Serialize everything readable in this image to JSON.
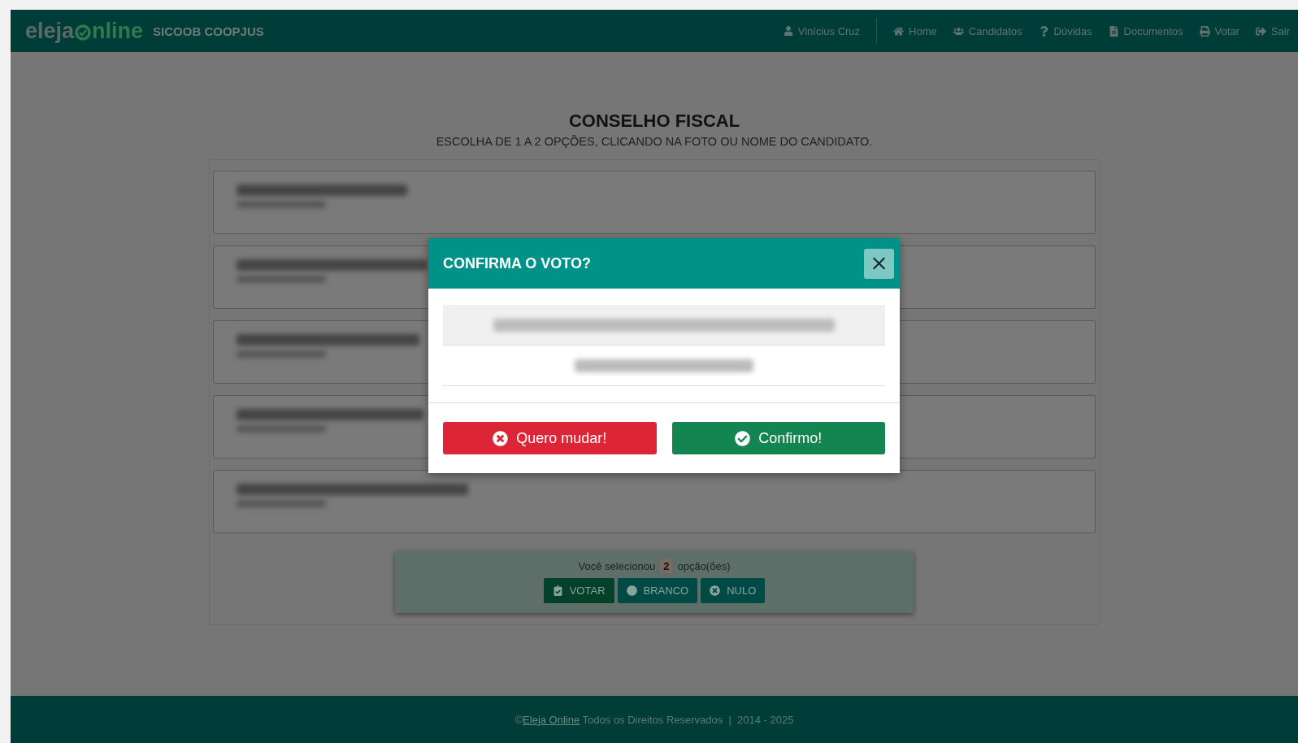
{
  "header": {
    "logo_left": "eleja",
    "logo_right": "nline",
    "org": "SICOOB COOPJUS",
    "user": "Vinícius Cruz",
    "nav": [
      "Home",
      "Candidatos",
      "Dúvidas",
      "Documentos",
      "Votar",
      "Sair"
    ]
  },
  "ballot": {
    "title": "CONSELHO FISCAL",
    "subtitle": "ESCOLHA DE 1 A 2 OPÇÕES, CLICANDO NA FOTO OU NOME DO CANDIDATO."
  },
  "selection": {
    "before": "Você selecionou",
    "count": "2",
    "after": "opção(ões)",
    "buttons": [
      {
        "kind": "vote",
        "label": "VOTAR"
      },
      {
        "kind": "blank",
        "label": "BRANCO"
      },
      {
        "kind": "null",
        "label": "NULO"
      }
    ]
  },
  "modal": {
    "title": "CONFIRMA O VOTO?",
    "cancel": "Quero mudar!",
    "confirm": "Confirmo!"
  },
  "footer": {
    "prefix": "©",
    "link": "Eleja Online",
    "text": "Todos os Direitos Reservados  |  2014 - 2025"
  }
}
